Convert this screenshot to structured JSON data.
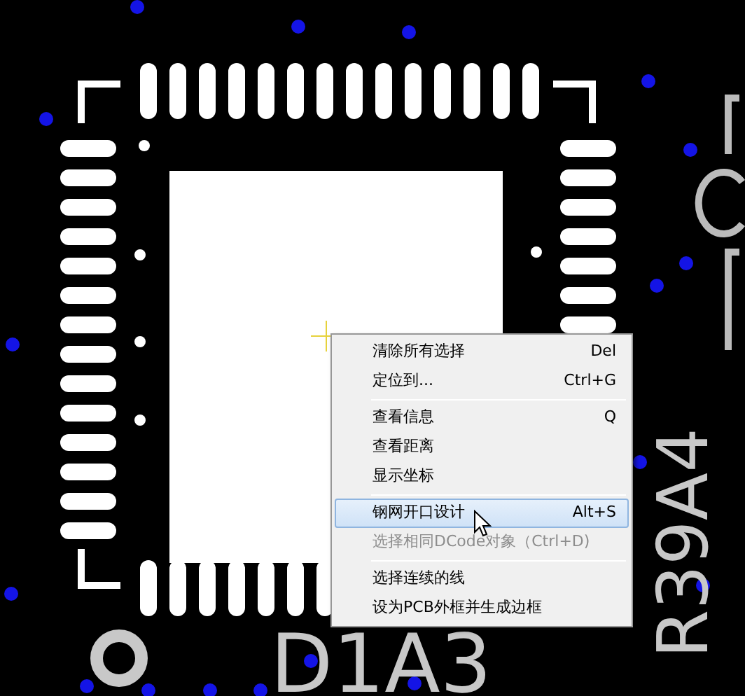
{
  "canvas": {
    "labels": [
      {
        "text": "D1A3",
        "kind": "horizontal"
      },
      {
        "text": "R39A4",
        "kind": "vertical"
      }
    ]
  },
  "context_menu": {
    "items": [
      {
        "kind": "item",
        "label": "清除所有选择",
        "shortcut": "Del",
        "selected": false,
        "disabled": false
      },
      {
        "kind": "item",
        "label": "定位到...",
        "shortcut": "Ctrl+G",
        "selected": false,
        "disabled": false
      },
      {
        "kind": "separator"
      },
      {
        "kind": "item",
        "label": "查看信息",
        "shortcut": "Q",
        "selected": false,
        "disabled": false
      },
      {
        "kind": "item",
        "label": "查看距离",
        "selected": false,
        "disabled": false
      },
      {
        "kind": "item",
        "label": "显示坐标",
        "selected": false,
        "disabled": false
      },
      {
        "kind": "separator"
      },
      {
        "kind": "item",
        "label": "钢网开口设计",
        "shortcut": "Alt+S",
        "selected": true,
        "disabled": false
      },
      {
        "kind": "item",
        "label": "选择相同DCode对象（Ctrl+D)",
        "selected": false,
        "disabled": true
      },
      {
        "kind": "separator"
      },
      {
        "kind": "item",
        "label": "选择连续的线",
        "selected": false,
        "disabled": false
      },
      {
        "kind": "item",
        "label": "设为PCB外框并生成边框",
        "selected": false,
        "disabled": false
      }
    ]
  }
}
